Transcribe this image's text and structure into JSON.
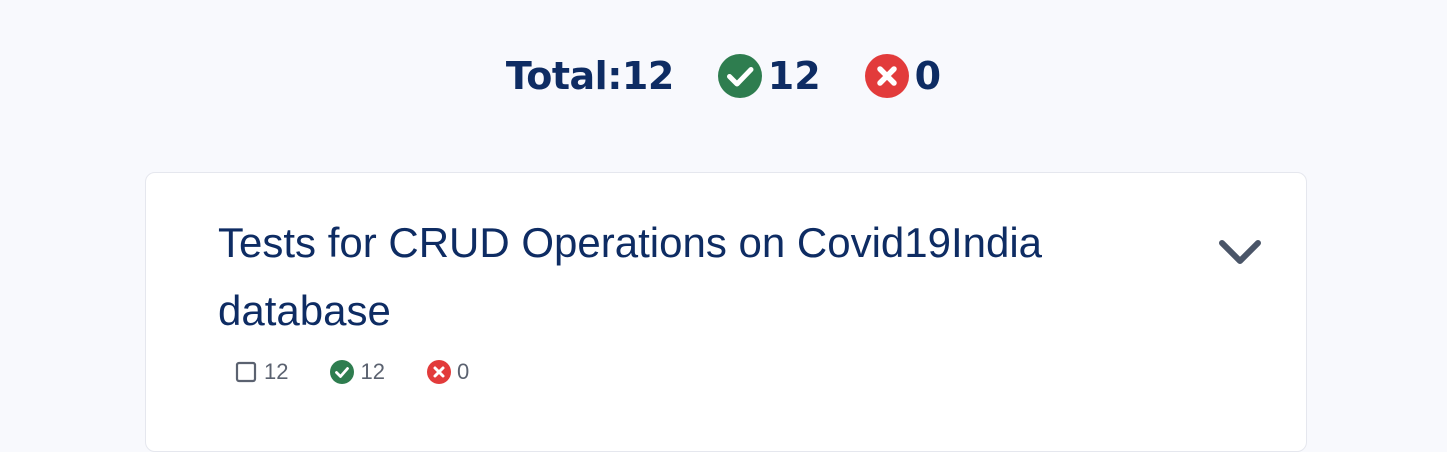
{
  "summary": {
    "total_label": "Total:12",
    "passed_count": "12",
    "failed_count": "0"
  },
  "suite": {
    "title": "Tests for CRUD Operations on Covid19India database",
    "stats": {
      "total": "12",
      "passed": "12",
      "failed": "0"
    }
  },
  "colors": {
    "background": "#f8f9fd",
    "text_primary": "#0e2c63",
    "pass_green": "#2e7d4f",
    "fail_red": "#e23b3b",
    "muted": "#5b6270",
    "chevron": "#4a5568"
  },
  "icons": {
    "pass": "check-circle-icon",
    "fail": "x-circle-icon",
    "total": "square-outline-icon",
    "expand": "chevron-down-icon"
  }
}
